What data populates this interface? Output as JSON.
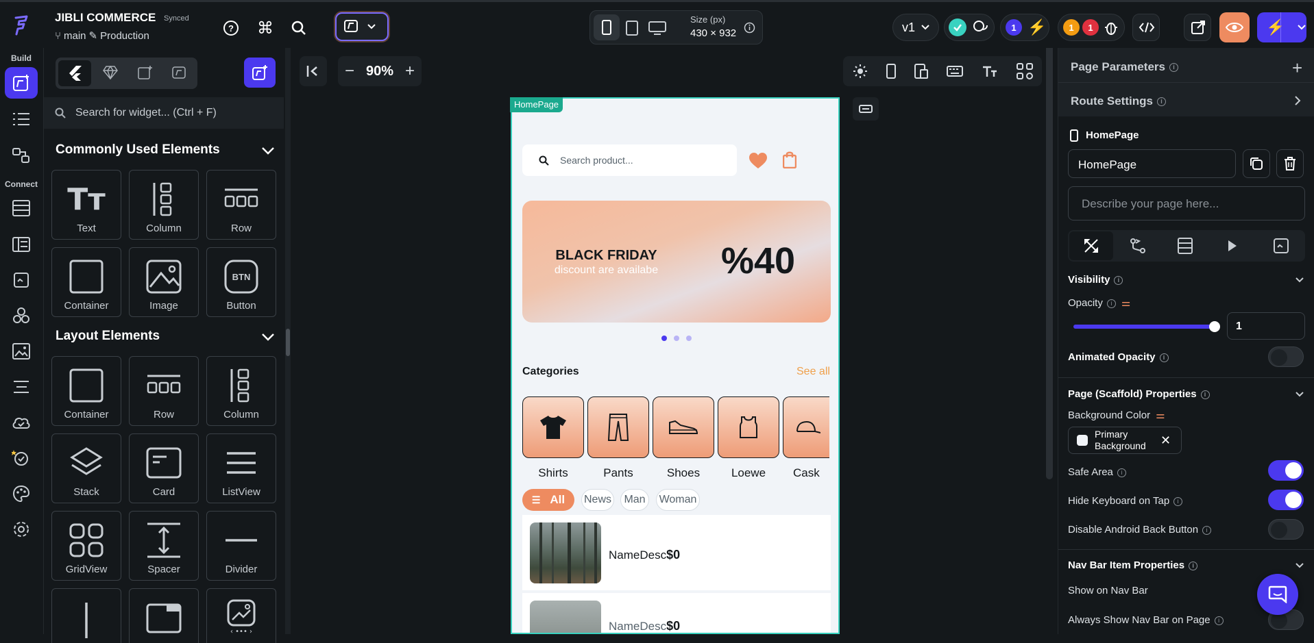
{
  "app": {
    "project_name": "JIBLI COMMERCE",
    "sync_status": "Synced",
    "branch": "main",
    "environment": "Production"
  },
  "topbar": {
    "size_label": "Size (px)",
    "size_value": "430 × 932",
    "version": "v1",
    "badge_purple_count": "1",
    "badge_orange_count": "1",
    "badge_red_count": "1"
  },
  "rail": {
    "build_label": "Build",
    "connect_label": "Connect"
  },
  "widgets": {
    "search_placeholder": "Search for widget... (Ctrl + F)",
    "common_title": "Commonly Used Elements",
    "common_items": [
      "Text",
      "Column",
      "Row",
      "Container",
      "Image",
      "Button"
    ],
    "layout_title": "Layout Elements",
    "layout_items": [
      "Container",
      "Row",
      "Column",
      "Stack",
      "Card",
      "ListView",
      "GridView",
      "Spacer",
      "Divider"
    ]
  },
  "canvas": {
    "zoom": "90%",
    "page_tag": "HomePage"
  },
  "phone": {
    "search_placeholder": "Search product...",
    "banner_title": "BLACK FRIDAY",
    "banner_subtitle": "discount are availabe",
    "banner_discount": "%40",
    "categories_title": "Categories",
    "see_all": "See all",
    "categories": [
      "Shirts",
      "Pants",
      "Shoes",
      "Loewe",
      "Cask"
    ],
    "filters": [
      "All",
      "News",
      "Man",
      "Woman"
    ],
    "products": [
      {
        "name_desc": "NameDesc",
        "price": "$0"
      },
      {
        "name_desc": "NameDesc",
        "price": "$0"
      }
    ]
  },
  "properties": {
    "page_parameters": "Page Parameters",
    "route_settings": "Route Settings",
    "page_label": "HomePage",
    "page_name_value": "HomePage",
    "description_placeholder": "Describe your page here...",
    "visibility": "Visibility",
    "opacity_label": "Opacity",
    "opacity_value": "1",
    "opacity_level": 1.0,
    "animated_opacity": "Animated Opacity",
    "scaffold_title": "Page (Scaffold) Properties",
    "background_color_label": "Background Color",
    "background_color_value": "Primary Background",
    "safe_area": "Safe Area",
    "hide_keyboard": "Hide Keyboard on Tap",
    "disable_back": "Disable Android Back Button",
    "navbar_title": "Nav Bar Item Properties",
    "show_on_navbar": "Show on Nav Bar",
    "always_show_navbar": "Always Show Nav Bar on Page"
  },
  "colors": {
    "accent": "#4b39ef",
    "orange": "#ee8b60",
    "teal": "#39d2c0",
    "background": "#14181b"
  }
}
